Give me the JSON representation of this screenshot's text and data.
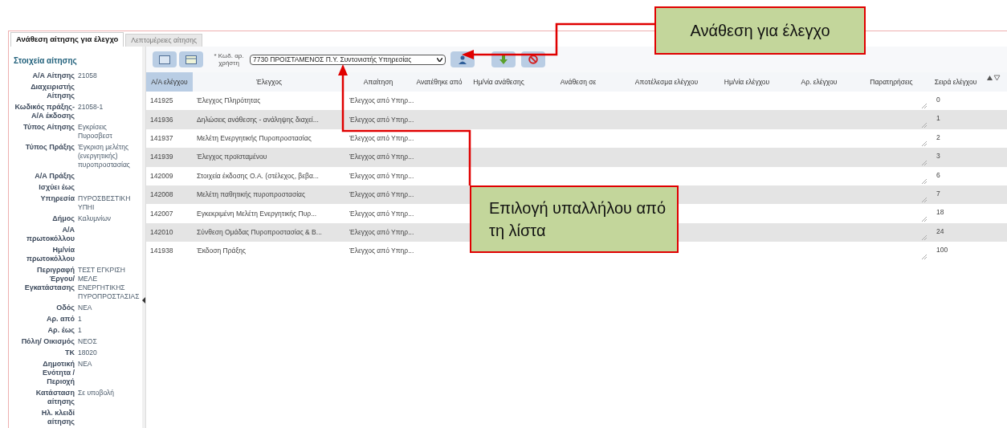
{
  "tabs": [
    {
      "label": "Ανάθεση αίτησης για έλεγχο",
      "selected": true
    },
    {
      "label": "Λεπτομέρειες αίτησης",
      "selected": false
    }
  ],
  "sidebar": {
    "title": "Στοιχεία αίτησης",
    "fields": [
      {
        "label": "Α/Α Αίτησης",
        "value": "21058"
      },
      {
        "label": "Διαχειριστής Αίτησης"
      },
      {
        "label": "Κωδικός πράξης-Α/Α έκδοσης",
        "value": "21058-1"
      },
      {
        "label": "Τύπος Αίτησης",
        "value": "Εγκρίσεις Πυροσβεστ"
      },
      {
        "label": "Τύπος Πράξης",
        "value": "Έγκριση μελέτης (ενεργητικής) πυροπροστασίας"
      },
      {
        "label": "Α/Α Πράξης"
      },
      {
        "label": "Ισχύει έως"
      },
      {
        "label": "Υπηρεσία",
        "value": "ΠΥΡΟΣΒΕΣΤΙΚΗ ΥΠΗΙ"
      },
      {
        "label": "Δήμος",
        "value": "Καλυμνίων"
      },
      {
        "label": "Α/Α πρωτοκόλλου"
      },
      {
        "label": "Ημ/νία πρωτοκόλλου"
      },
      {
        "label": "Περιγραφή Έργου/ Εγκατάστασης",
        "value": "ΤΕΣΤ ΕΓΚΡΙΣΗ ΜΕΛΕ ΕΝΕΡΓΗΤΙΚΗΣ ΠΥΡΟΠΡΟΣΤΑΣΙΑΣ"
      },
      {
        "label": "Οδός",
        "value": "ΝΕΑ"
      },
      {
        "label": "Αρ. από",
        "value": "1"
      },
      {
        "label": "Αρ. έως",
        "value": "1"
      },
      {
        "label": "Πόλη/ Οικισμός",
        "value": "ΝΕΟΣ"
      },
      {
        "label": "ΤΚ",
        "value": "18020"
      },
      {
        "label": "Δημοτική Ενότητα / Περιοχή",
        "value": "ΝΕΑ"
      },
      {
        "label": "Κατάσταση αίτησης",
        "value": "Σε υποβολή"
      },
      {
        "label": "Ηλ. κλειδί αίτησης"
      }
    ]
  },
  "toolbar": {
    "user_label": "* Κωδ. αρ. χρήστη",
    "user_select": "7730 ΠΡΟΙΣΤΑΜΕΝΟΣ Π.Υ. Συντονιστής Υπηρεσίας"
  },
  "table": {
    "columns": [
      "Α/Α ελέγχου",
      "Έλεγχος",
      "Απαίτηση",
      "Ανατέθηκε από",
      "Ημ/νία ανάθεσης",
      "Ανάθεση σε",
      "Αποτέλεσμα ελέγχου",
      "Ημ/νία ελέγχου",
      "Αρ. ελέγχου",
      "Παρατηρήσεις",
      "Σειρά ελέγχου"
    ],
    "rows": [
      {
        "id": "141925",
        "check": "Έλεγχος Πληρότητας",
        "requirement": "Έλεγχος από Υπηρ...",
        "order": "0"
      },
      {
        "id": "141936",
        "check": "Δηλώσεις ανάθεσης - ανάληψης διαχεί...",
        "requirement": "Έλεγχος από Υπηρ...",
        "order": "1"
      },
      {
        "id": "141937",
        "check": "Μελέτη Ενεργητικής Πυροπροστασίας",
        "requirement": "Έλεγχος από Υπηρ...",
        "order": "2"
      },
      {
        "id": "141939",
        "check": "Έλεγχος προϊσταμένου",
        "requirement": "Έλεγχος από Υπηρ...",
        "order": "3"
      },
      {
        "id": "142009",
        "check": "Στοιχεία έκδοσης Ο.Α. (στέλεχος, βεβα...",
        "requirement": "Έλεγχος από Υπηρ...",
        "order": "6"
      },
      {
        "id": "142008",
        "check": "Μελέτη παθητικής πυροπροστασίας",
        "requirement": "Έλεγχος από Υπηρ...",
        "order": "7"
      },
      {
        "id": "142007",
        "check": "Εγκεκριμένη Μελέτη Ενεργητικής Πυρ...",
        "requirement": "Έλεγχος από Υπηρ...",
        "order": "18"
      },
      {
        "id": "142010",
        "check": "Σύνθεση Ομάδας Πυροπροστασίας & Β...",
        "requirement": "Έλεγχος από Υπηρ...",
        "order": "24"
      },
      {
        "id": "141938",
        "check": "Έκδοση Πράξης",
        "requirement": "Έλεγχος από Υπηρ...",
        "order": "100"
      }
    ]
  },
  "callouts": [
    {
      "text": "Ανάθεση για έλεγχο"
    },
    {
      "text": "Επιλογή υπαλλήλου από τη λίστα"
    }
  ]
}
